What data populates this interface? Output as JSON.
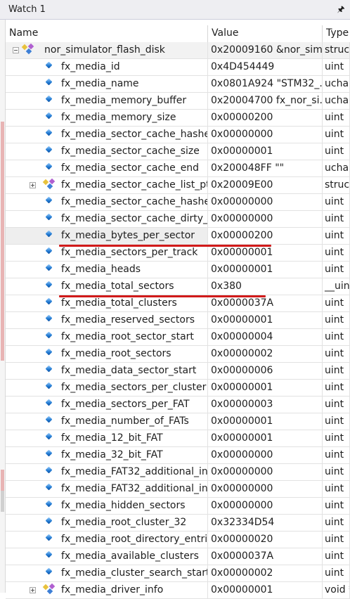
{
  "window": {
    "title": "Watch 1",
    "pin_icon": "pin-icon"
  },
  "header": {
    "name": "Name",
    "value": "Value",
    "type": "Type"
  },
  "rows": [
    {
      "name": "nor_simulator_flash_disk",
      "value": "0x20009160 &nor_sim...",
      "type": "struct",
      "icon": "struct-icon",
      "expander": "minus",
      "level": 0
    },
    {
      "name": "fx_media_id",
      "value": "0x4D454449",
      "type": "uint",
      "icon": "field-icon",
      "level": 1
    },
    {
      "name": "fx_media_name",
      "value": "0x0801A924 \"STM32_...",
      "type": "uchar",
      "icon": "field-icon",
      "level": 1
    },
    {
      "name": "fx_media_memory_buffer",
      "value": "0x20004700 fx_nor_si...",
      "type": "uchar",
      "icon": "field-icon",
      "level": 1
    },
    {
      "name": "fx_media_memory_size",
      "value": "0x00000200",
      "type": "uint",
      "icon": "field-icon",
      "level": 1
    },
    {
      "name": "fx_media_sector_cache_hashed",
      "value": "0x00000000",
      "type": "uint",
      "icon": "field-icon",
      "level": 1
    },
    {
      "name": "fx_media_sector_cache_size",
      "value": "0x00000001",
      "type": "uint",
      "icon": "field-icon",
      "level": 1
    },
    {
      "name": "fx_media_sector_cache_end",
      "value": "0x200048FF \"\"",
      "type": "uchar",
      "icon": "field-icon",
      "level": 1
    },
    {
      "name": "fx_media_sector_cache_list_ptr",
      "value": "0x20009E00",
      "type": "struct",
      "icon": "struct-icon",
      "expander": "plus",
      "level": 1
    },
    {
      "name": "fx_media_sector_cache_hashe...",
      "value": "0x00000000",
      "type": "uint",
      "icon": "field-icon",
      "level": 1
    },
    {
      "name": "fx_media_sector_cache_dirty_...",
      "value": "0x00000000",
      "type": "uint",
      "icon": "field-icon",
      "level": 1
    },
    {
      "name": "fx_media_bytes_per_sector",
      "value": "0x00000200",
      "type": "uint",
      "icon": "field-icon",
      "level": 1
    },
    {
      "name": "fx_media_sectors_per_track",
      "value": "0x00000001",
      "type": "uint",
      "icon": "field-icon",
      "level": 1
    },
    {
      "name": "fx_media_heads",
      "value": "0x00000001",
      "type": "uint",
      "icon": "field-icon",
      "level": 1
    },
    {
      "name": "fx_media_total_sectors",
      "value": "0x380",
      "type": "__uint",
      "icon": "field-icon",
      "level": 1
    },
    {
      "name": "fx_media_total_clusters",
      "value": "0x0000037A",
      "type": "uint",
      "icon": "field-icon",
      "level": 1
    },
    {
      "name": "fx_media_reserved_sectors",
      "value": "0x00000001",
      "type": "uint",
      "icon": "field-icon",
      "level": 1
    },
    {
      "name": "fx_media_root_sector_start",
      "value": "0x00000004",
      "type": "uint",
      "icon": "field-icon",
      "level": 1
    },
    {
      "name": "fx_media_root_sectors",
      "value": "0x00000002",
      "type": "uint",
      "icon": "field-icon",
      "level": 1
    },
    {
      "name": "fx_media_data_sector_start",
      "value": "0x00000006",
      "type": "uint",
      "icon": "field-icon",
      "level": 1
    },
    {
      "name": "fx_media_sectors_per_cluster",
      "value": "0x00000001",
      "type": "uint",
      "icon": "field-icon",
      "level": 1
    },
    {
      "name": "fx_media_sectors_per_FAT",
      "value": "0x00000003",
      "type": "uint",
      "icon": "field-icon",
      "level": 1
    },
    {
      "name": "fx_media_number_of_FATs",
      "value": "0x00000001",
      "type": "uint",
      "icon": "field-icon",
      "level": 1
    },
    {
      "name": "fx_media_12_bit_FAT",
      "value": "0x00000001",
      "type": "uint",
      "icon": "field-icon",
      "level": 1
    },
    {
      "name": "fx_media_32_bit_FAT",
      "value": "0x00000000",
      "type": "uint",
      "icon": "field-icon",
      "level": 1
    },
    {
      "name": "fx_media_FAT32_additional_in...",
      "value": "0x00000000",
      "type": "uint",
      "icon": "field-icon",
      "level": 1
    },
    {
      "name": "fx_media_FAT32_additional_in...",
      "value": "0x00000000",
      "type": "uint",
      "icon": "field-icon",
      "level": 1
    },
    {
      "name": "fx_media_hidden_sectors",
      "value": "0x00000000",
      "type": "uint",
      "icon": "field-icon",
      "level": 1
    },
    {
      "name": "fx_media_root_cluster_32",
      "value": "0x32334D54",
      "type": "uint",
      "icon": "field-icon",
      "level": 1
    },
    {
      "name": "fx_media_root_directory_entri...",
      "value": "0x00000020",
      "type": "uint",
      "icon": "field-icon",
      "level": 1
    },
    {
      "name": "fx_media_available_clusters",
      "value": "0x0000037A",
      "type": "uint",
      "icon": "field-icon",
      "level": 1
    },
    {
      "name": "fx_media_cluster_search_start",
      "value": "0x00000002",
      "type": "uint",
      "icon": "field-icon",
      "level": 1
    },
    {
      "name": "fx_media_driver_info",
      "value": "0x00000001",
      "type": "void *",
      "icon": "struct-icon",
      "expander": "plus",
      "level": 1
    }
  ],
  "highlighted_rows": [
    "fx_media_bytes_per_sector",
    "fx_media_total_sectors"
  ],
  "colors": {
    "highlight_underline": "#d11a1a",
    "selected_row": "#eeeeee"
  }
}
